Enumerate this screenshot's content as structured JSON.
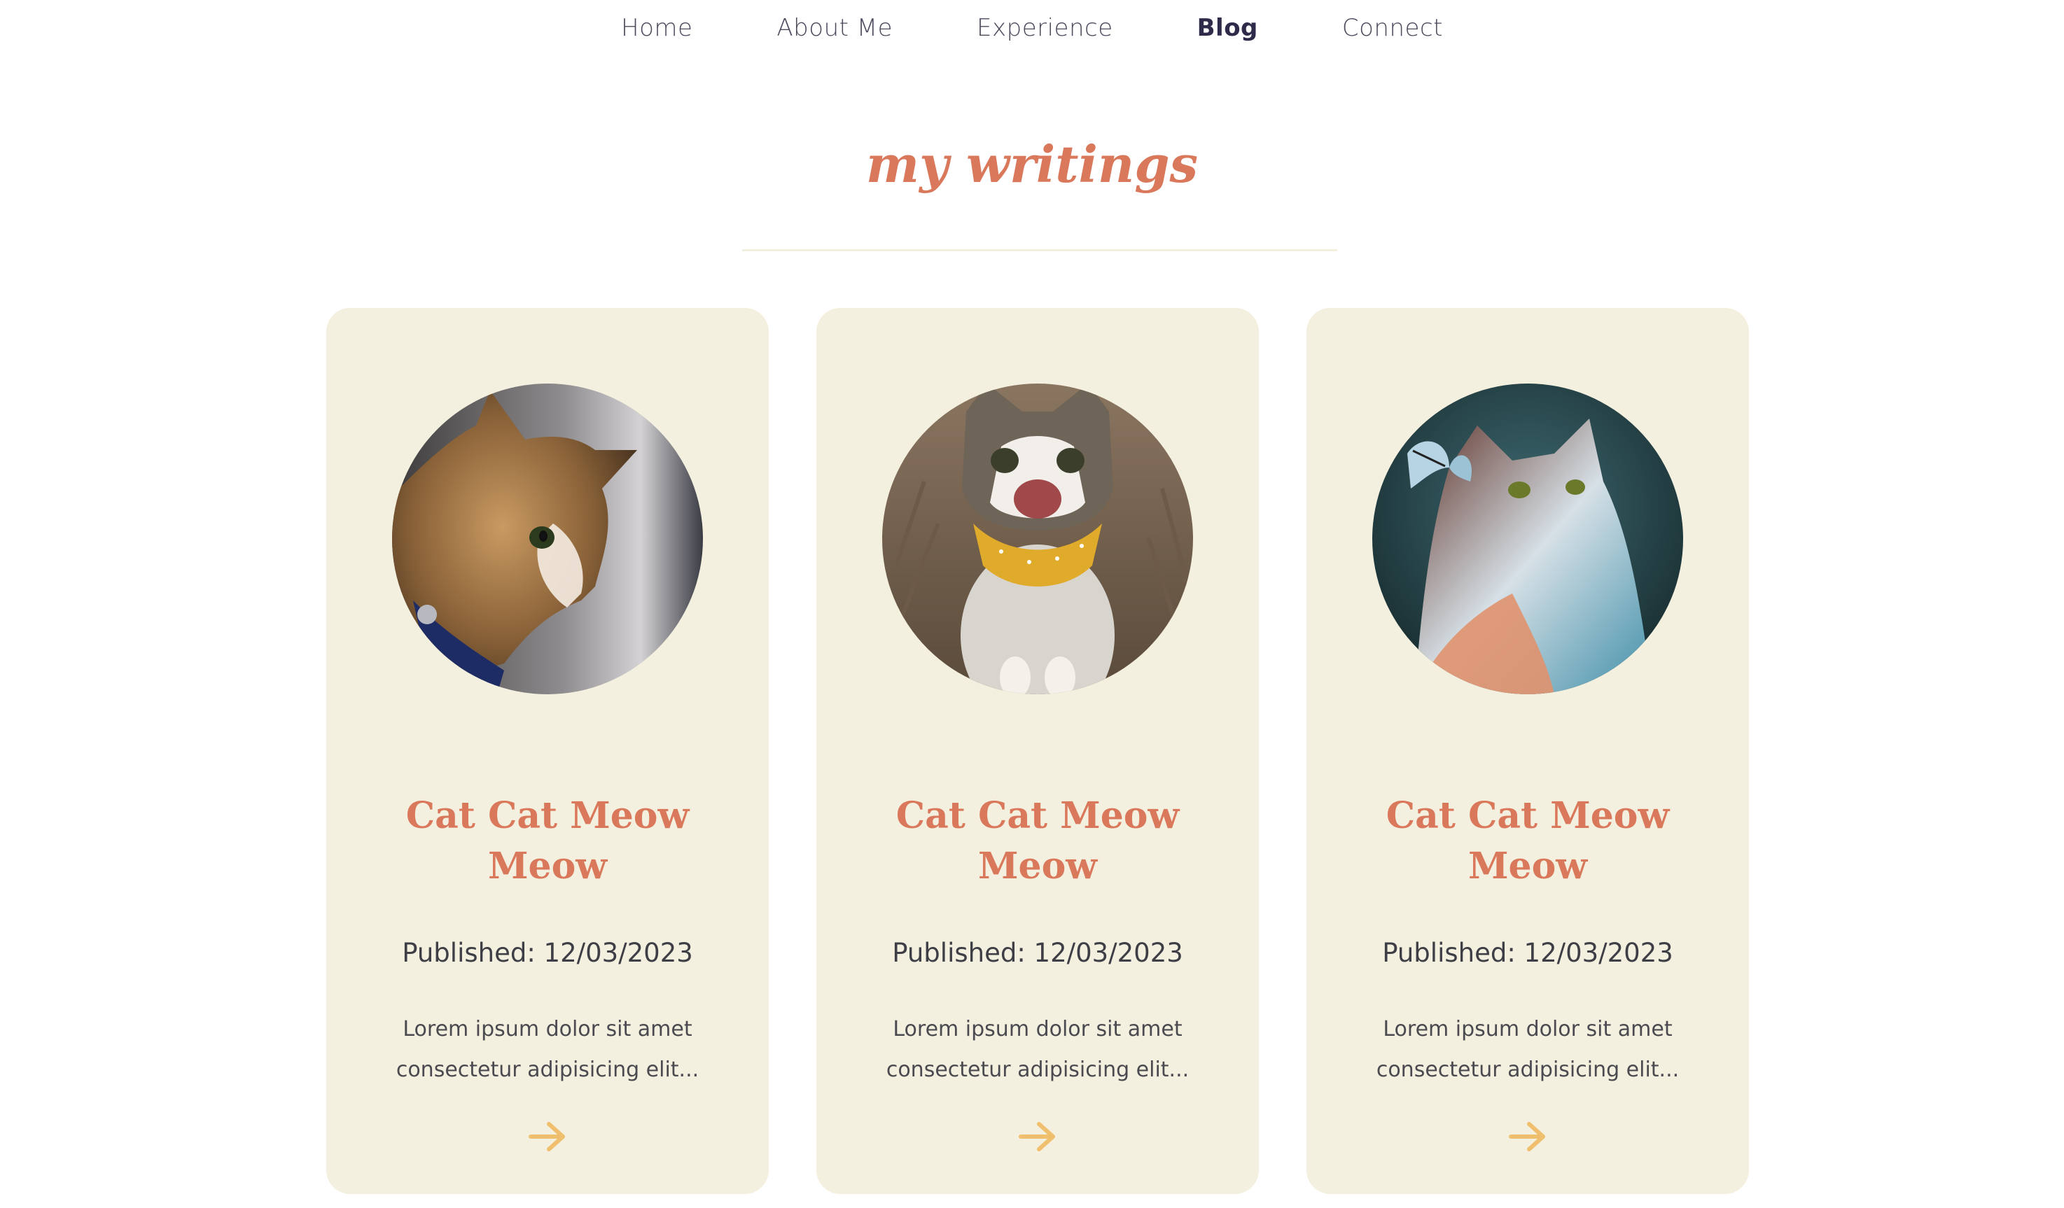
{
  "nav": {
    "items": [
      {
        "label": "Home"
      },
      {
        "label": "About Me"
      },
      {
        "label": "Experience"
      },
      {
        "label": "Blog",
        "active": true
      },
      {
        "label": "Connect"
      }
    ]
  },
  "heading": "my writings",
  "colors": {
    "accent": "#d9785b",
    "card_bg": "#f4f0df",
    "arrow": "#f0bf6e",
    "nav_text": "#4a4a5c"
  },
  "posts": [
    {
      "title_line1": "Cat Cat Meow",
      "title_line2": "Meow",
      "date": "Published: 12/03/2023",
      "excerpt_line1": "Lorem ipsum dolor sit amet",
      "excerpt_line2": "consectetur adipisicing elit...",
      "photo_icon": "cat-photo-orange-tabby-profile",
      "arrow_icon": "arrow-right-icon"
    },
    {
      "title_line1": "Cat Cat Meow",
      "title_line2": "Meow",
      "date": "Published: 12/03/2023",
      "excerpt_line1": "Lorem ipsum dolor sit amet",
      "excerpt_line2": "consectetur adipisicing elit...",
      "photo_icon": "cat-photo-happy-tabby-bandana",
      "arrow_icon": "arrow-right-icon"
    },
    {
      "title_line1": "Cat Cat Meow",
      "title_line2": "Meow",
      "date": "Published: 12/03/2023",
      "excerpt_line1": "Lorem ipsum dolor sit amet",
      "excerpt_line2": "consectetur adipisicing elit...",
      "photo_icon": "cat-photo-fluffy-with-butterfly",
      "arrow_icon": "arrow-right-icon"
    }
  ]
}
